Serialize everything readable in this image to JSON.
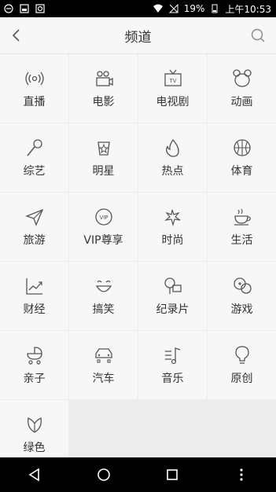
{
  "status_bar": {
    "battery": "19%",
    "time": "上午10:53"
  },
  "header": {
    "title": "频道"
  },
  "channels": [
    {
      "label": "直播",
      "icon": "live-icon"
    },
    {
      "label": "电影",
      "icon": "movie-icon"
    },
    {
      "label": "电视剧",
      "icon": "tv-icon"
    },
    {
      "label": "动画",
      "icon": "animation-icon"
    },
    {
      "label": "综艺",
      "icon": "microphone-icon"
    },
    {
      "label": "明星",
      "icon": "star-icon"
    },
    {
      "label": "热点",
      "icon": "flame-icon"
    },
    {
      "label": "体育",
      "icon": "basketball-icon"
    },
    {
      "label": "旅游",
      "icon": "paper-plane-icon"
    },
    {
      "label": "VIP尊享",
      "icon": "vip-icon"
    },
    {
      "label": "时尚",
      "icon": "sparkle-icon"
    },
    {
      "label": "生活",
      "icon": "coffee-icon"
    },
    {
      "label": "财经",
      "icon": "finance-chart-icon"
    },
    {
      "label": "搞笑",
      "icon": "smile-icon"
    },
    {
      "label": "纪录片",
      "icon": "documentary-icon"
    },
    {
      "label": "游戏",
      "icon": "gamepad-icon"
    },
    {
      "label": "亲子",
      "icon": "stroller-icon"
    },
    {
      "label": "汽车",
      "icon": "car-icon"
    },
    {
      "label": "音乐",
      "icon": "music-icon"
    },
    {
      "label": "原创",
      "icon": "lightbulb-icon"
    },
    {
      "label": "绿色",
      "icon": "leaf-icon"
    }
  ]
}
